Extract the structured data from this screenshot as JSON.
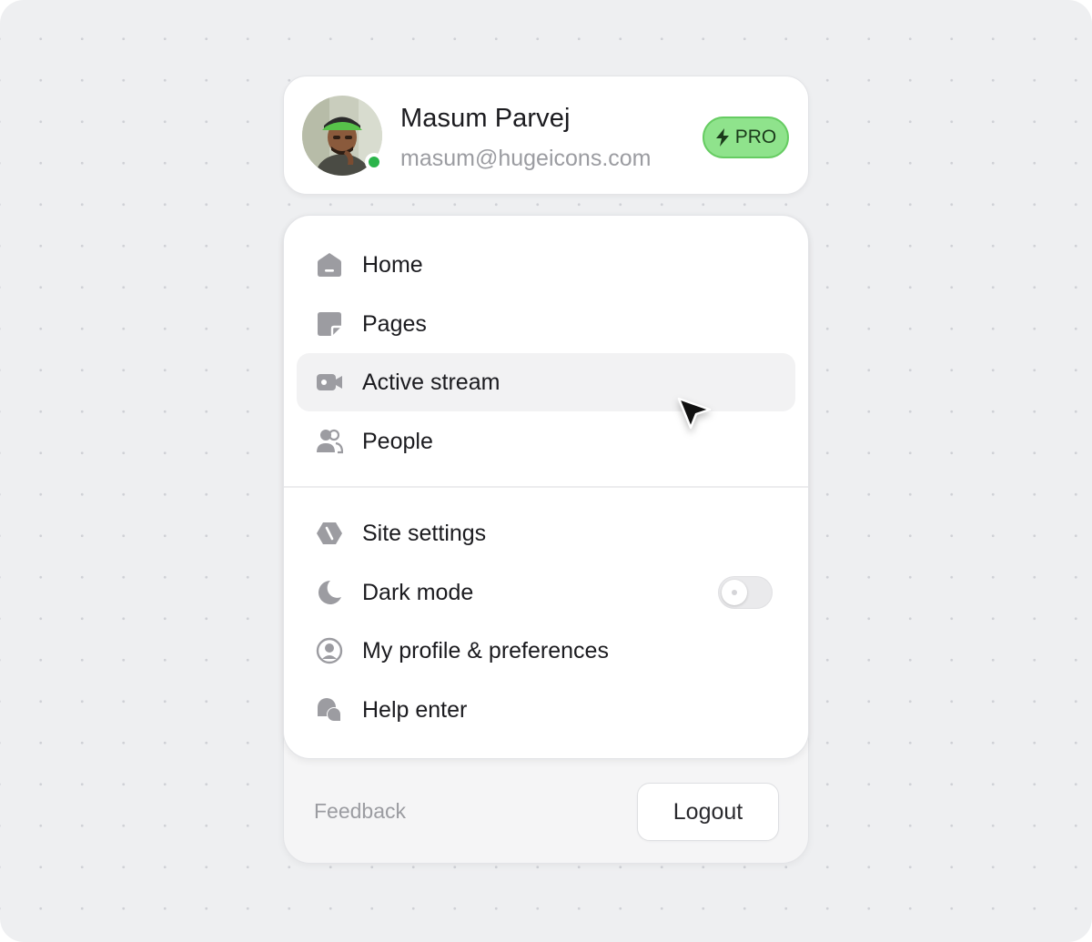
{
  "profile": {
    "name": "Masum Parvej",
    "email": "masum@hugeicons.com",
    "badge": "PRO",
    "status": "online",
    "badge_color": "#8fe38c",
    "status_color": "#2bb44a"
  },
  "menu": {
    "primary": [
      {
        "label": "Home",
        "icon": "home-icon"
      },
      {
        "label": "Pages",
        "icon": "note-icon"
      },
      {
        "label": "Active stream",
        "icon": "video-camera-icon",
        "active": true
      },
      {
        "label": "People",
        "icon": "users-icon"
      }
    ],
    "secondary": [
      {
        "label": "Site settings",
        "icon": "settings-hexagon-icon"
      },
      {
        "label": "Dark mode",
        "icon": "moon-icon",
        "toggle": false
      },
      {
        "label": "My profile & preferences",
        "icon": "user-circle-icon"
      },
      {
        "label": "Help enter",
        "icon": "chat-bubbles-icon"
      }
    ]
  },
  "footer": {
    "feedback_label": "Feedback",
    "logout_label": "Logout"
  },
  "colors": {
    "icon": "#9c9ca1",
    "active_row": "#f2f2f3"
  }
}
